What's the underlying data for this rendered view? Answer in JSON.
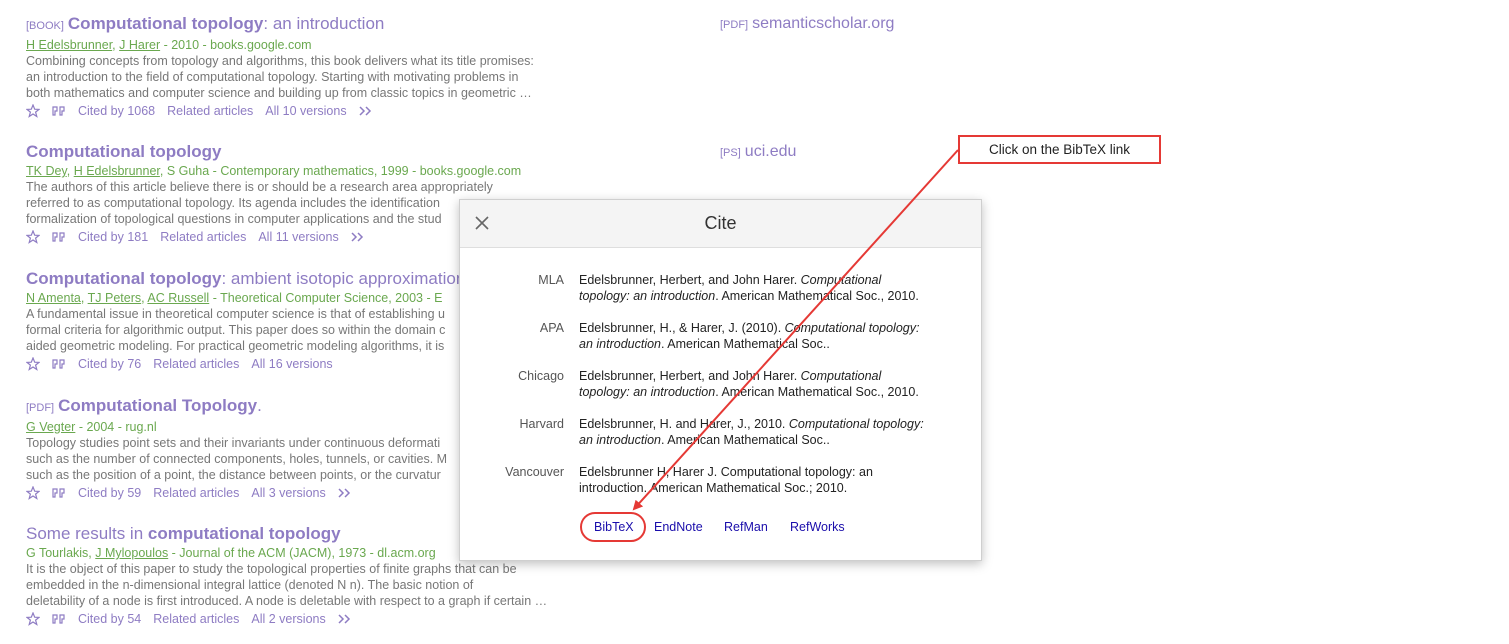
{
  "results": [
    {
      "tag": "[BOOK]",
      "title_bold": "Computational topology",
      "title_rest": ": an introduction",
      "authors": [
        "H Edelsbrunner",
        "J Harer"
      ],
      "source": " - 2010 - books.google.com",
      "snippet": [
        "Combining concepts from topology and algorithms, this book delivers what its title promises:",
        "an introduction to the field of computational topology. Starting with motivating problems in",
        "both mathematics and computer science and building up from classic topics in geometric …"
      ],
      "cited_by": "Cited by 1068",
      "related": "Related articles",
      "versions": "All 10 versions",
      "side_tag": "[PDF]",
      "side_link": "semanticscholar.org"
    },
    {
      "tag": "",
      "title_bold": "Computational topology",
      "title_rest": "",
      "authors": [
        "TK Dey",
        "H Edelsbrunner"
      ],
      "source": ", S Guha - Contemporary mathematics, 1999 - books.google.com",
      "snippet": [
        "The authors of this article believe there is or should be a research area appropriately",
        "referred to as computational topology. Its agenda includes the identification",
        "formalization of topological questions in computer applications and the stud"
      ],
      "cited_by": "Cited by 181",
      "related": "Related articles",
      "versions": "All 11 versions",
      "side_tag": "[PS]",
      "side_link": "uci.edu"
    },
    {
      "tag": "",
      "title_bold": "Computational topology",
      "title_rest": ": ambient isotopic approximation",
      "authors": [
        "N Amenta",
        "TJ Peters",
        "AC Russell"
      ],
      "source": " - Theoretical Computer Science, 2003 - E",
      "snippet": [
        "A fundamental issue in theoretical computer science is that of establishing u",
        "formal criteria for algorithmic output. This paper does so within the domain c",
        "aided geometric modeling. For practical geometric modeling algorithms, it is"
      ],
      "cited_by": "Cited by 76",
      "related": "Related articles",
      "versions": "All 16 versions",
      "side_tag": "",
      "side_link": ""
    },
    {
      "tag": "[PDF]",
      "title_bold": "Computational Topology",
      "title_rest": ".",
      "authors": [
        "G Vegter"
      ],
      "source": " - 2004 - rug.nl",
      "snippet": [
        "Topology studies point sets and their invariants under continuous deformati",
        "such as the number of connected components, holes, tunnels, or cavities. M",
        "such as the position of a point, the distance between points, or the curvatur"
      ],
      "cited_by": "Cited by 59",
      "related": "Related articles",
      "versions": "All 3 versions",
      "side_tag": "",
      "side_link": ""
    },
    {
      "tag": "",
      "title_pre": "Some results in ",
      "title_bold": "computational topology",
      "title_rest": "",
      "authors_pre": "G Tourlakis, ",
      "authors": [
        "J Mylopoulos"
      ],
      "source": " - Journal of the ACM (JACM), 1973 - dl.acm.org",
      "snippet": [
        "It is the object of this paper to study the topological properties of finite graphs that can be",
        "embedded in the n-dimensional integral lattice (denoted N n). The basic notion of",
        "deletability of a node is first introduced. A node is deletable with respect to a graph if certain …"
      ],
      "cited_by": "Cited by 54",
      "related": "Related articles",
      "versions": "All 2 versions",
      "side_tag": "",
      "side_link": ""
    }
  ],
  "cite_modal": {
    "title": "Cite",
    "formats": [
      {
        "name": "MLA",
        "line1_pre": "Edelsbrunner, Herbert, and John Harer. ",
        "line1_it": "Computational",
        "line2_it": "topology: an introduction",
        "line2_post": ". American Mathematical Soc., 2010."
      },
      {
        "name": "APA",
        "line1_pre": "Edelsbrunner, H., & Harer, J. (2010). ",
        "line1_it": "Computational topology:",
        "line2_it": "an introduction",
        "line2_post": ". American Mathematical Soc.."
      },
      {
        "name": "Chicago",
        "line1_pre": "Edelsbrunner, Herbert, and John Harer. ",
        "line1_it": "Computational",
        "line2_it": "topology: an introduction",
        "line2_post": ". American Mathematical Soc., 2010."
      },
      {
        "name": "Harvard",
        "line1_pre": "Edelsbrunner, H. and Harer, J., 2010. ",
        "line1_it": "Computational topology:",
        "line2_it": "an introduction",
        "line2_post": ". American Mathematical Soc.."
      },
      {
        "name": "Vancouver",
        "line1_pre": "Edelsbrunner H, Harer J. Computational topology: an",
        "line1_it": "",
        "line2_it": "",
        "line2_post": "introduction. American Mathematical Soc.; 2010."
      }
    ],
    "exports": [
      "BibTeX",
      "EndNote",
      "RefMan",
      "RefWorks"
    ]
  },
  "annotation": {
    "callout_text": "Click on the BibTeX link",
    "color": "#e53935"
  },
  "colors": {
    "link_purple": "#8e7cc3",
    "author_green": "#6aa84f",
    "export_blue": "#1a0dab"
  }
}
